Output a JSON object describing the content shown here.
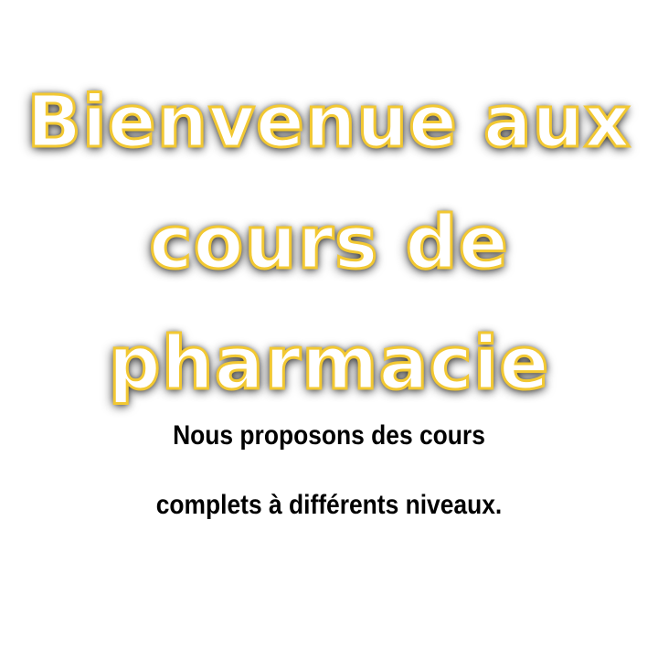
{
  "headline": {
    "lines": [
      "Bienvenue aux",
      "cours de",
      "pharmacie"
    ],
    "fill_color": "#ffffff",
    "outline_color": "#f2c832"
  },
  "subtitle": {
    "lines": [
      "Nous proposons des cours",
      "complets à différents niveaux."
    ],
    "color": "#000000"
  },
  "background_color": "#ffffff"
}
